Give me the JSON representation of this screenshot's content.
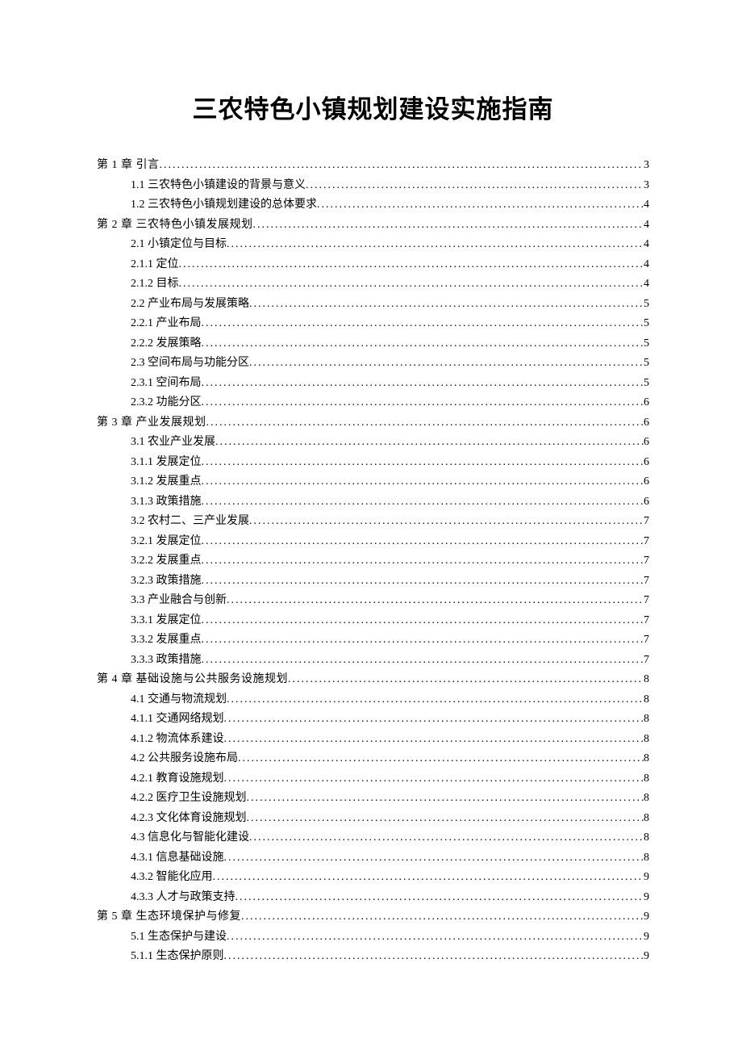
{
  "title": "三农特色小镇规划建设实施指南",
  "toc": [
    {
      "level": 0,
      "label": "第 1 章  引言",
      "page": "3"
    },
    {
      "level": 1,
      "label": "1.1 三农特色小镇建设的背景与意义",
      "page": "3"
    },
    {
      "level": 1,
      "label": "1.2 三农特色小镇规划建设的总体要求",
      "page": "4"
    },
    {
      "level": 0,
      "label": "第 2 章  三农特色小镇发展规划",
      "page": "4"
    },
    {
      "level": 1,
      "label": "2.1 小镇定位与目标",
      "page": "4"
    },
    {
      "level": 1,
      "label": "2.1.1 定位",
      "page": "4"
    },
    {
      "level": 1,
      "label": "2.1.2 目标",
      "page": "4"
    },
    {
      "level": 1,
      "label": "2.2 产业布局与发展策略",
      "page": "5"
    },
    {
      "level": 1,
      "label": "2.2.1 产业布局",
      "page": "5"
    },
    {
      "level": 1,
      "label": "2.2.2 发展策略",
      "page": "5"
    },
    {
      "level": 1,
      "label": "2.3 空间布局与功能分区",
      "page": "5"
    },
    {
      "level": 1,
      "label": "2.3.1 空间布局",
      "page": "5"
    },
    {
      "level": 1,
      "label": "2.3.2 功能分区",
      "page": "6"
    },
    {
      "level": 0,
      "label": "第 3 章  产业发展规划",
      "page": "6"
    },
    {
      "level": 1,
      "label": "3.1 农业产业发展",
      "page": "6"
    },
    {
      "level": 1,
      "label": "3.1.1 发展定位",
      "page": "6"
    },
    {
      "level": 1,
      "label": "3.1.2 发展重点",
      "page": "6"
    },
    {
      "level": 1,
      "label": "3.1.3 政策措施",
      "page": "6"
    },
    {
      "level": 1,
      "label": "3.2 农村二、三产业发展",
      "page": "7"
    },
    {
      "level": 1,
      "label": "3.2.1 发展定位",
      "page": "7"
    },
    {
      "level": 1,
      "label": "3.2.2 发展重点",
      "page": "7"
    },
    {
      "level": 1,
      "label": "3.2.3 政策措施",
      "page": "7"
    },
    {
      "level": 1,
      "label": "3.3 产业融合与创新",
      "page": "7"
    },
    {
      "level": 1,
      "label": "3.3.1 发展定位",
      "page": "7"
    },
    {
      "level": 1,
      "label": "3.3.2 发展重点",
      "page": "7"
    },
    {
      "level": 1,
      "label": "3.3.3 政策措施",
      "page": "7"
    },
    {
      "level": 0,
      "label": "第 4 章  基础设施与公共服务设施规划",
      "page": "8"
    },
    {
      "level": 1,
      "label": "4.1 交通与物流规划",
      "page": "8"
    },
    {
      "level": 1,
      "label": "4.1.1 交通网络规划",
      "page": "8"
    },
    {
      "level": 1,
      "label": "4.1.2 物流体系建设",
      "page": "8"
    },
    {
      "level": 1,
      "label": "4.2 公共服务设施布局",
      "page": "8"
    },
    {
      "level": 1,
      "label": "4.2.1 教育设施规划",
      "page": "8"
    },
    {
      "level": 1,
      "label": "4.2.2 医疗卫生设施规划",
      "page": "8"
    },
    {
      "level": 1,
      "label": "4.2.3 文化体育设施规划",
      "page": "8"
    },
    {
      "level": 1,
      "label": "4.3 信息化与智能化建设",
      "page": "8"
    },
    {
      "level": 1,
      "label": "4.3.1 信息基础设施",
      "page": "8"
    },
    {
      "level": 1,
      "label": "4.3.2 智能化应用",
      "page": "9"
    },
    {
      "level": 1,
      "label": "4.3.3 人才与政策支持",
      "page": "9"
    },
    {
      "level": 0,
      "label": "第 5 章  生态环境保护与修复",
      "page": "9"
    },
    {
      "level": 1,
      "label": "5.1 生态保护与建设",
      "page": "9"
    },
    {
      "level": 1,
      "label": "5.1.1 生态保护原则",
      "page": "9"
    }
  ]
}
